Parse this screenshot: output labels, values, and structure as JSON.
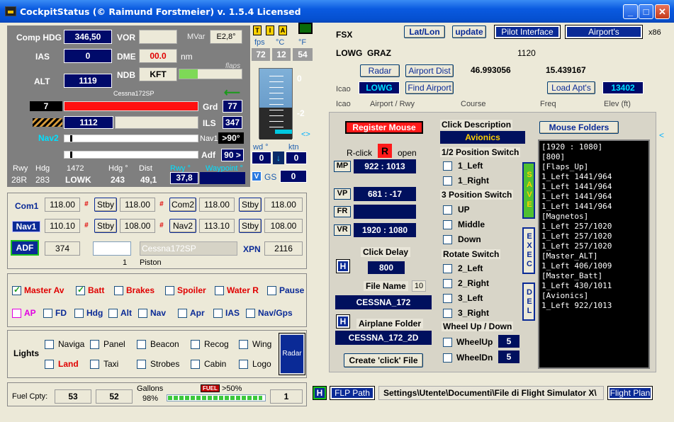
{
  "window": {
    "title": "CockpitStatus (© Raimund Forstmeier) v. 1.5.4 Licensed",
    "min": "_",
    "max": "□",
    "close": "✕"
  },
  "instruments": {
    "comp_hdg_label": "Comp HDG",
    "comp_hdg": "346,50",
    "vor_label": "VOR",
    "mvar_label": "MVar",
    "mvar": "E2,8°",
    "ias_label": "IAS",
    "ias": "0",
    "dme_label": "DME",
    "dme": "00.0",
    "dme_unit": "nm",
    "alt_label": "ALT",
    "alt": "1119",
    "ndb_label": "NDB",
    "ndb": "KFT",
    "flaps_label": "flaps",
    "aircraft": "Cessna172SP",
    "com_sel": "7",
    "grd_label": "Grd",
    "grd": "77",
    "ils_left": "1112",
    "ils_label": "ILS",
    "ils": "347",
    "nav2_label": "Nav2",
    "nav1_label": "Nav1",
    "nav1": ">90°",
    "adf_label": "Adf",
    "adf": "90 >",
    "rwy_label": "Rwy",
    "hdg_label": "Hdg",
    "rwy_hdg_label": "Hdg °",
    "dist_label": "Dist",
    "rwy_deg_label": "Rwy °",
    "waypoint_label": "Waypoint °",
    "rwy": "28R",
    "hdg": "283",
    "n1472": "1472",
    "airport": "LOWK",
    "hdg2": "243",
    "dist": "49,1",
    "rwy_deg": "37,8"
  },
  "gauges": {
    "t_icon": "T",
    "i_icon": "I",
    "a_icon": "A",
    "fps_label": "fps",
    "c_label": "°C",
    "f_label": "°F",
    "fps": "72",
    "c": "12",
    "f": "54",
    "top": "0",
    "mid": "-2",
    "wd_label": "wd °",
    "ktn_label": "ktn",
    "wd": "0",
    "ktn": "0",
    "v_label": "V",
    "gs_label": "GS",
    "gs": "0"
  },
  "fsx": {
    "fsx_label": "FSX",
    "latlon": "Lat/Lon",
    "update": "update",
    "pilot": "Pilot Interface",
    "airports": "Airport's",
    "x86": "x86",
    "lowg": "LOWG",
    "graz": "GRAZ",
    "elev_val": "1120",
    "radar": "Radar",
    "airport_dist": "Airport Dist",
    "lat": "46.993056",
    "lon": "15.439167",
    "icao_label": "Icao",
    "icao": "LOWG",
    "find": "Find Airport",
    "load": "Load Apt's",
    "freq_val": "13402",
    "col_icao": "Icao",
    "col_apt": "Airport / Rwy",
    "col_course": "Course",
    "col_freq": "Freq",
    "col_elev": "Elev (ft)"
  },
  "radios": {
    "com1": "Com1",
    "com1_act": "118.00",
    "stby": "Stby",
    "com1_stby": "118.00",
    "com2": "Com2",
    "com2_act": "118.00",
    "com2_stby": "118.00",
    "nav1": "Nav1",
    "nav1_act": "110.10",
    "nav1_stby": "108.00",
    "nav2": "Nav2",
    "nav2_act": "113.10",
    "nav2_stby": "108.00",
    "adf": "ADF",
    "adf_val": "374",
    "acft_field": "Cessna172SP",
    "xpn_label": "XPN",
    "xpn": "2116",
    "eng_count": "1",
    "eng_type": "Piston",
    "hash": "#"
  },
  "switches": {
    "master_av": "Master Av",
    "batt": "Batt",
    "brakes": "Brakes",
    "spoiler": "Spoiler",
    "water": "Water R",
    "pause": "Pause",
    "ap": "AP",
    "fd": "FD",
    "hdg": "Hdg",
    "alt": "Alt",
    "nav": "Nav",
    "apr": "Apr",
    "ias": "IAS",
    "navgps": "Nav/Gps"
  },
  "lights": {
    "title": "Lights",
    "naviga": "Naviga",
    "panel": "Panel",
    "beacon": "Beacon",
    "recog": "Recog",
    "wing": "Wing",
    "land": "Land",
    "taxi": "Taxi",
    "strobes": "Strobes",
    "cabin": "Cabin",
    "logo": "Logo",
    "radar": "Radar"
  },
  "fuel": {
    "label": "Fuel Cpty:",
    "left": "53",
    "right": "52",
    "gallons": "Gallons",
    "pct": "98%",
    "fuel_icon": "FUEL",
    "gt50": ">50%",
    "tanks": "1"
  },
  "mouse": {
    "register": "Register Mouse",
    "rclick": "R-click",
    "r": "R",
    "open": "open",
    "mp_label": "MP",
    "mp": "922 : 1013",
    "vp_label": "VP",
    "vp": "681 : -17",
    "fr_label": "FR",
    "vr_label": "VR",
    "vr": "1920 : 1080",
    "delay_label": "Click Delay",
    "delay": "800",
    "h": "H",
    "file_label": "File Name",
    "file_num": "10",
    "file": "CESSNA_172",
    "folder_label": "Airplane Folder",
    "folder": "CESSNA_172_2D",
    "create": "Create 'click' File",
    "desc_label": "Click Description",
    "desc": "Avionics",
    "pos2_label": "1/2  Position Switch",
    "left1": "1_Left",
    "right1": "1_Right",
    "pos3_label": "3 Position Switch",
    "up": "UP",
    "middle": "Middle",
    "down": "Down",
    "rotate_label": "Rotate Switch",
    "left2": "2_Left",
    "right2": "2_Right",
    "left3": "3_Left",
    "right3": "3_Right",
    "wheel_label": "Wheel Up / Down",
    "wheelup": "WheelUp",
    "wheelup_val": "5",
    "wheeldn": "WheelDn",
    "wheeldn_val": "5",
    "save": "SAVE",
    "exec": "EXEC",
    "del": "DEL",
    "folders_btn": "Mouse Folders",
    "list": [
      "[1920 : 1080]",
      "[800]",
      "[Flaps_Up]",
      "1_Left 1441/964",
      "1_Left 1441/964",
      "1_Left 1441/964",
      "1_Left 1441/964",
      "[Magnetos]",
      "1_Left 257/1020",
      "1_Left 257/1020",
      "1_Left 257/1020",
      "[Master_ALT]",
      "1_Left 406/1009",
      "[Master_Batt]",
      "1_Left 430/1011",
      "[Avionics]",
      "1_Left 922/1013"
    ]
  },
  "bottom": {
    "h": "H",
    "flp": "FLP Path",
    "path": "Settings\\Utente\\Documenti\\File di Flight Simulator X\\",
    "plan": "Flight Plan"
  }
}
